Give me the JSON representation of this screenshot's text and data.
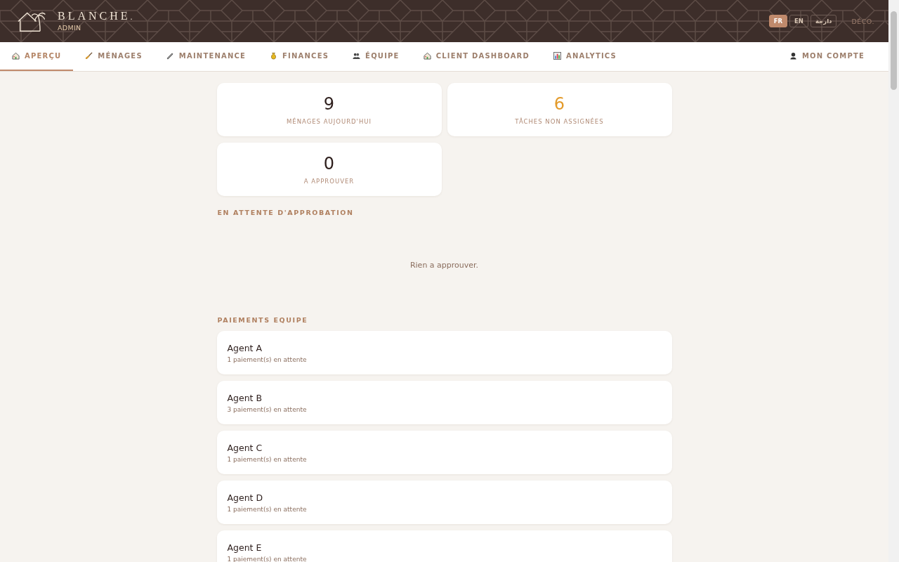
{
  "brand": {
    "name": "BLANCHE",
    "dot": ".",
    "role": "ADMIN"
  },
  "languages": [
    {
      "label": "FR",
      "selected": true
    },
    {
      "label": "EN",
      "selected": false
    },
    {
      "label": "دارجة",
      "selected": false
    }
  ],
  "logout": "DÉCO.",
  "nav": [
    {
      "label": "APERÇU",
      "selected": true
    },
    {
      "label": "MÉNAGES",
      "selected": false
    },
    {
      "label": "MAINTENANCE",
      "selected": false
    },
    {
      "label": "FINANCES",
      "selected": false
    },
    {
      "label": "ÉQUIPE",
      "selected": false
    },
    {
      "label": "CLIENT DASHBOARD",
      "selected": false
    },
    {
      "label": "ANALYTICS",
      "selected": false
    }
  ],
  "account": {
    "label": "MON COMPTE"
  },
  "stats": [
    {
      "value": "9",
      "label": "MÉNAGES AUJOURD'HUI",
      "color": "#2d1e1c"
    },
    {
      "value": "6",
      "label": "TÂCHES NON ASSIGNÉES",
      "color": "#e39a2a"
    },
    {
      "value": "0",
      "label": "A APPROUVER",
      "color": "#2d1e1c"
    }
  ],
  "approval": {
    "title": "EN ATTENTE D'APPROBATION",
    "empty": "Rien a approuver."
  },
  "payments": {
    "title": "PAIEMENTS EQUIPE",
    "agents": [
      {
        "name": "Agent A",
        "detail": "1 paiement(s) en attente"
      },
      {
        "name": "Agent B",
        "detail": "3 paiement(s) en attente"
      },
      {
        "name": "Agent C",
        "detail": "1 paiement(s) en attente"
      },
      {
        "name": "Agent D",
        "detail": "1 paiement(s) en attente"
      },
      {
        "name": "Agent E",
        "detail": "1 paiement(s) en attente"
      }
    ]
  }
}
